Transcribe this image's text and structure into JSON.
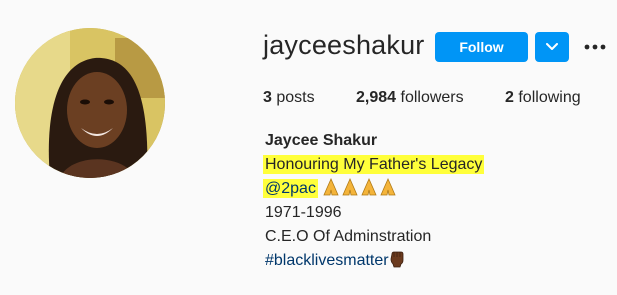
{
  "profile": {
    "username": "jayceeshakur",
    "follow_label": "Follow",
    "stats": {
      "posts_count": "3",
      "posts_label": "posts",
      "followers_count": "2,984",
      "followers_label": "followers",
      "following_count": "2",
      "following_label": "following"
    },
    "bio": {
      "full_name": "Jaycee Shakur",
      "line1": "Honouring My Father's Legacy",
      "mention": "@2pac",
      "line3": "1971-1996",
      "line4": "C.E.O Of Adminstration",
      "hashtag": "#blacklivesmatter"
    },
    "highlight_color": "#ffff3a",
    "accent_color": "#0095f6",
    "link_color": "#00376b"
  },
  "icons": {
    "dropdown": "chevron-down-icon",
    "more": "more-options-icon",
    "prayer": "folded-hands-emoji",
    "fist": "raised-fist-emoji"
  }
}
